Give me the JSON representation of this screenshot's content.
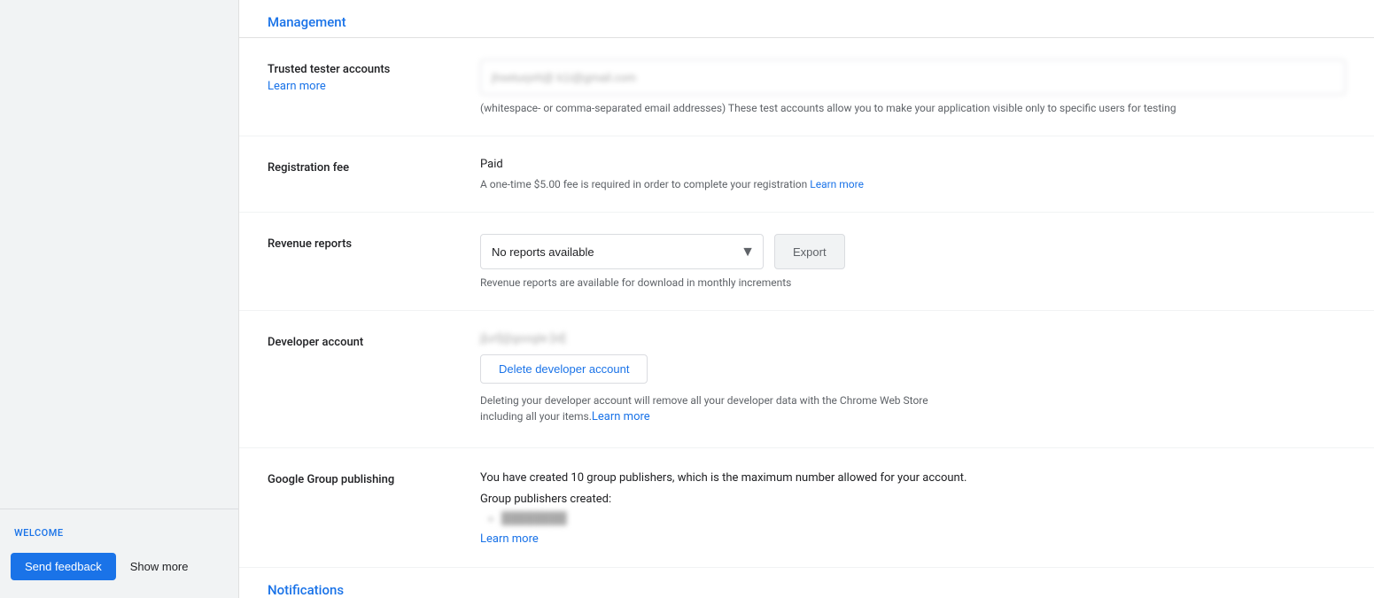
{
  "sidebar": {
    "welcome_label": "WELCOME",
    "send_feedback_label": "Send feedback",
    "show_more_label": "Show more"
  },
  "management": {
    "section_title": "Management",
    "trusted_tester": {
      "label": "Trusted tester accounts",
      "learn_more": "Learn more",
      "input_value": "jhseturp#t@ k1i@gmail.com",
      "input_hint": "(whitespace- or comma-separated email addresses) These test accounts allow you to make your application visible only to specific users for testing"
    },
    "registration_fee": {
      "label": "Registration fee",
      "status": "Paid",
      "description": "A one-time $5.00 fee is required in order to complete your registration",
      "learn_more": "Learn more"
    },
    "revenue_reports": {
      "label": "Revenue reports",
      "select_option": "No reports available",
      "export_label": "Export",
      "hint": "Revenue reports are available for download in monthly increments"
    },
    "developer_account": {
      "label": "Developer account",
      "email_blurred": "j[url]@google [id]",
      "delete_btn_label": "Delete developer account",
      "warning_text": "Deleting your developer account will remove all your developer data with the Chrome Web Store including all your items.",
      "learn_more": "Learn more"
    },
    "google_group": {
      "label": "Google Group publishing",
      "description": "You have created 10 group publishers, which is the maximum number allowed for your account.",
      "publishers_created_label": "Group publishers created:",
      "publisher_blurred": "[blurred-publisher-name]",
      "learn_more": "Learn more"
    }
  },
  "notifications": {
    "section_title": "Notifications"
  }
}
